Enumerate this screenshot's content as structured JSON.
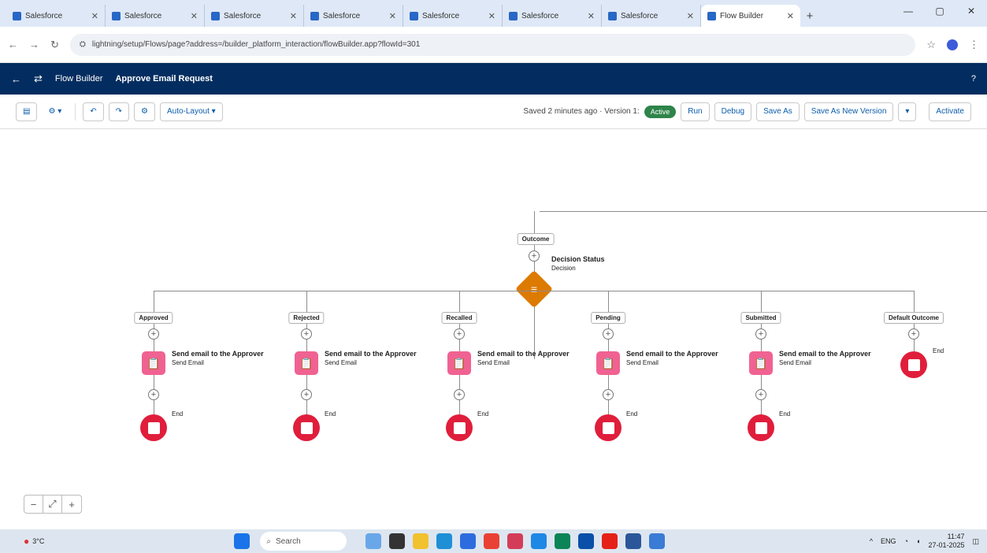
{
  "tabs": [
    {
      "label": "Salesforce"
    },
    {
      "label": "Salesforce"
    },
    {
      "label": "Salesforce"
    },
    {
      "label": "Salesforce"
    },
    {
      "label": "Salesforce"
    },
    {
      "label": "Salesforce"
    },
    {
      "label": "Salesforce"
    },
    {
      "label": "Flow Builder"
    }
  ],
  "window_controls": {
    "minimize": "—",
    "maximize": "▢",
    "close": "✕"
  },
  "address": {
    "back": "←",
    "forward": "→",
    "reload": "↻",
    "url": "lightning/setup/Flows/page?address=/builder_platform_interaction/flowBuilder.app?flowId=301",
    "star": "☆"
  },
  "appbar": {
    "back": "←",
    "app_name": "Flow Builder",
    "flow_name": "Approve Email Request",
    "help": "?"
  },
  "toolbar": {
    "undo": "↶",
    "redo": "↷",
    "layout": "Auto-Layout",
    "status_text": "Saved 2 minutes ago · Version 1:",
    "badge": "Active",
    "run": "Run",
    "debug": "Debug",
    "save_as": "Save As",
    "save_new": "Save As New Version",
    "activate": "Activate"
  },
  "canvas": {
    "top_label": "Outcome",
    "decision": {
      "title": "Decision Status",
      "subtitle": "Decision"
    },
    "branches": [
      {
        "label": "Approved",
        "action_title": "Send email to the Approver",
        "action_sub": "Send Email",
        "end": "End"
      },
      {
        "label": "Rejected",
        "action_title": "Send email to the Approver",
        "action_sub": "Send Email",
        "end": "End"
      },
      {
        "label": "Recalled",
        "action_title": "Send email to the Approver",
        "action_sub": "Send Email",
        "end": "End"
      },
      {
        "label": "Pending",
        "action_title": "Send email to the Approver",
        "action_sub": "Send Email",
        "end": "End"
      },
      {
        "label": "Submitted",
        "action_title": "Send email to the Approver",
        "action_sub": "Send Email",
        "end": "End"
      },
      {
        "label": "Default Outcome",
        "end": "End"
      }
    ],
    "zoom": {
      "out": "−",
      "fit": "⤢",
      "in": "+"
    }
  },
  "taskbar": {
    "weather": "3°C",
    "search_placeholder": "Search",
    "tray_lang": "ENG",
    "time": "11:47",
    "date": "27-01-2025"
  },
  "colors": {
    "app_header": "#032d60",
    "action": "#f06292",
    "end": "#e01e3c",
    "decision": "#dd7a01",
    "badge": "#2e844a"
  }
}
